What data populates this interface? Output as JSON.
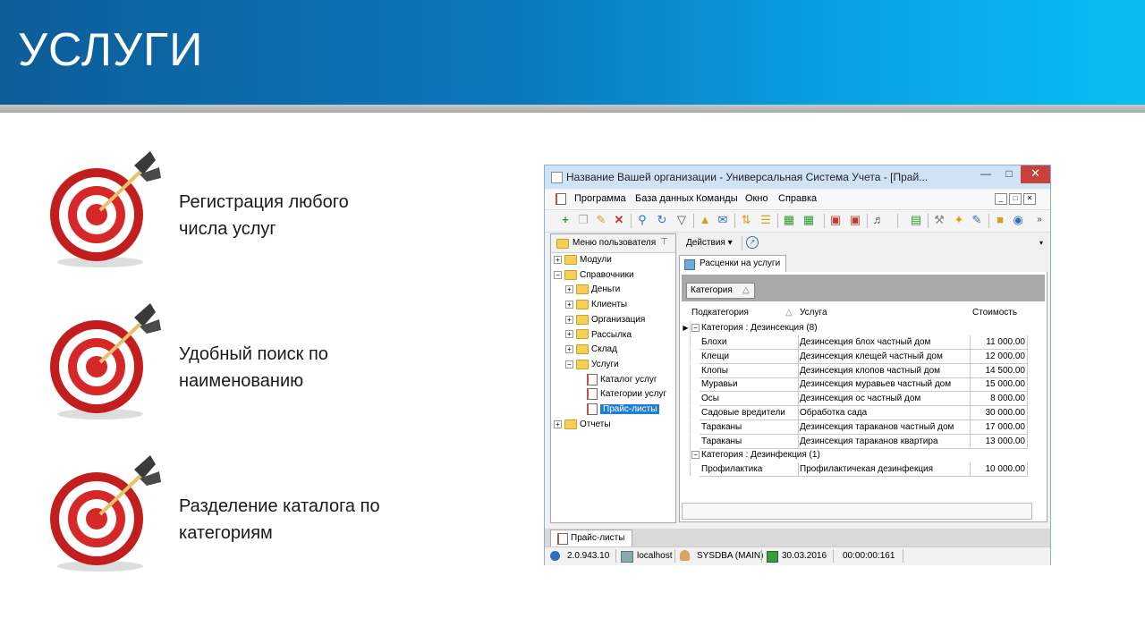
{
  "slide": {
    "title": "УСЛУГИ",
    "features": [
      {
        "text": "Регистрация любого\nчисла услуг"
      },
      {
        "text": "Удобный поиск по\nнаименованию"
      },
      {
        "text": "Разделение каталога по\nкатегориям"
      }
    ]
  },
  "window": {
    "title": "Название Вашей организации - Универсальная Система Учета - [Прай...",
    "menu": [
      "Программа",
      "База данных",
      "Команды",
      "Окно",
      "Справка"
    ],
    "left_panel": {
      "header": "Меню пользователя",
      "tree": [
        {
          "label": "Модули",
          "level": 0,
          "expander": "+",
          "icon": "folder"
        },
        {
          "label": "Справочники",
          "level": 0,
          "expander": "−",
          "icon": "folder-open"
        },
        {
          "label": "Деньги",
          "level": 1,
          "expander": "+",
          "icon": "folder"
        },
        {
          "label": "Клиенты",
          "level": 1,
          "expander": "+",
          "icon": "folder"
        },
        {
          "label": "Организация",
          "level": 1,
          "expander": "+",
          "icon": "folder"
        },
        {
          "label": "Рассылка",
          "level": 1,
          "expander": "+",
          "icon": "folder"
        },
        {
          "label": "Склад",
          "level": 1,
          "expander": "+",
          "icon": "folder"
        },
        {
          "label": "Услуги",
          "level": 1,
          "expander": "−",
          "icon": "folder-open"
        },
        {
          "label": "Каталог услуг",
          "level": 2,
          "expander": "",
          "icon": "document"
        },
        {
          "label": "Категории услуг",
          "level": 2,
          "expander": "",
          "icon": "document"
        },
        {
          "label": "Прайс-листы",
          "level": 2,
          "expander": "",
          "icon": "document",
          "selected": true
        },
        {
          "label": "Отчеты",
          "level": 0,
          "expander": "+",
          "icon": "folder"
        }
      ]
    },
    "actions_label": "Действия",
    "tab_label": "Расценки на услуги",
    "group_chip": "Категория",
    "columns": {
      "sub": "Подкатегория",
      "service": "Услуга",
      "cost": "Стоимость"
    },
    "groups": [
      {
        "label": "Категория : Дезинсекция (8)",
        "rows": [
          {
            "sub": "Блохи",
            "service": "Дезинсекция блох частный дом",
            "cost": "11 000.00"
          },
          {
            "sub": "Клещи",
            "service": "Дезинсекция клещей частный дом",
            "cost": "12 000.00"
          },
          {
            "sub": "Клопы",
            "service": "Дезинсекция клопов частный дом",
            "cost": "14 500.00"
          },
          {
            "sub": "Муравьи",
            "service": "Дезинсекция муравьев частный дом",
            "cost": "15 000.00"
          },
          {
            "sub": "Осы",
            "service": "Дезинсекция ос частный дом",
            "cost": "8 000.00"
          },
          {
            "sub": "Садовые вредители",
            "service": "Обработка сада",
            "cost": "30 000.00"
          },
          {
            "sub": "Тараканы",
            "service": "Дезинсекция тараканов частный дом",
            "cost": "17 000.00"
          },
          {
            "sub": "Тараканы",
            "service": "Дезинсекция тараканов квартира",
            "cost": "13 000.00"
          }
        ]
      },
      {
        "label": "Категория : Дезинфекция (1)",
        "rows": [
          {
            "sub": "Профилактика",
            "service": "Профилактичекая дезинфекция",
            "cost": "10 000.00"
          }
        ]
      }
    ],
    "bottom_tab": "Прайс-листы",
    "status": {
      "version": "2.0.943.10",
      "host": "localhost",
      "user": "SYSDBA (MAIN)",
      "date": "30.03.2016",
      "timer": "00:00:00:161"
    }
  }
}
